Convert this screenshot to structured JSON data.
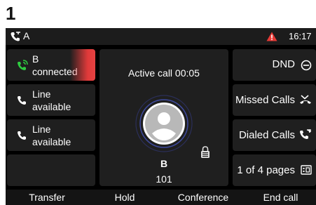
{
  "step_number": "1",
  "status_bar": {
    "account": "A",
    "time": "16:17",
    "icons": [
      "phone-call-icon",
      "warning-icon"
    ],
    "warning_color": "#e53935"
  },
  "lines": [
    {
      "label": "B",
      "sublabel": "connected",
      "state": "active",
      "icon": "phone-active-icon",
      "icon_color": "#2ecc40"
    },
    {
      "label": "Line",
      "sublabel": "available",
      "state": "idle",
      "icon": "phone-icon"
    },
    {
      "label": "Line",
      "sublabel": "available",
      "state": "idle",
      "icon": "phone-icon"
    },
    {
      "label": "",
      "sublabel": "",
      "state": "empty"
    }
  ],
  "call": {
    "status": "Active call 00:05",
    "contact_name": "B",
    "contact_number": "101",
    "icons": [
      "avatar-icon",
      "sip-lock-icon"
    ]
  },
  "right_keys": [
    {
      "label": "DND",
      "icon": "dnd-icon"
    },
    {
      "label": "Missed Calls",
      "icon": "missed-call-icon"
    },
    {
      "label": "Dialed Calls",
      "icon": "dialed-call-icon"
    },
    {
      "label": "1 of 4 pages",
      "icon": "page-icon"
    }
  ],
  "softkeys": [
    "Transfer",
    "Hold",
    "Conference",
    "End call"
  ],
  "colors": {
    "background": "#000000",
    "tile": "#1f1f1f",
    "accent_red": "#e03a3a",
    "accent_green": "#2ecc40"
  }
}
